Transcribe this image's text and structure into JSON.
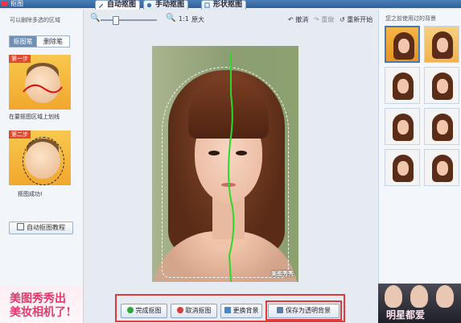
{
  "window": {
    "title": "抠图"
  },
  "tabs": [
    {
      "label": "自动抠图",
      "active": true
    },
    {
      "label": "手动抠图",
      "active": false
    },
    {
      "label": "形状抠图",
      "active": false
    }
  ],
  "left_panel": {
    "hint": "可以删除多选的区域",
    "mode_tabs": {
      "active": "抠图笔",
      "inactive": "删除笔"
    },
    "step1": {
      "tag": "第一步",
      "caption": "在要抠图区域上划线"
    },
    "step2": {
      "tag": "第二步",
      "caption": "抠图成功!"
    },
    "tutorial_button": "自动抠图教程",
    "ad": {
      "line1": "美图秀秀出",
      "line2": "美妆相机了!"
    }
  },
  "toolbar": {
    "zoom_level": "1:1",
    "original_size": "原大",
    "undo": "撤消",
    "redo": "重做",
    "restart": "重新开始"
  },
  "canvas": {
    "watermark": "美图秀秀"
  },
  "actions": {
    "done": "完成抠图",
    "cancel": "取消抠图",
    "replace_bg": "更换背景",
    "save_transparent": "保存为透明背景"
  },
  "right_panel": {
    "title": "您之前使用过的背景",
    "ad": {
      "text": "明星都爱"
    }
  },
  "colors": {
    "accent_red": "#e23a3a",
    "ad_pink": "#e23a6a",
    "guide_line_green": "#2bd92b"
  }
}
